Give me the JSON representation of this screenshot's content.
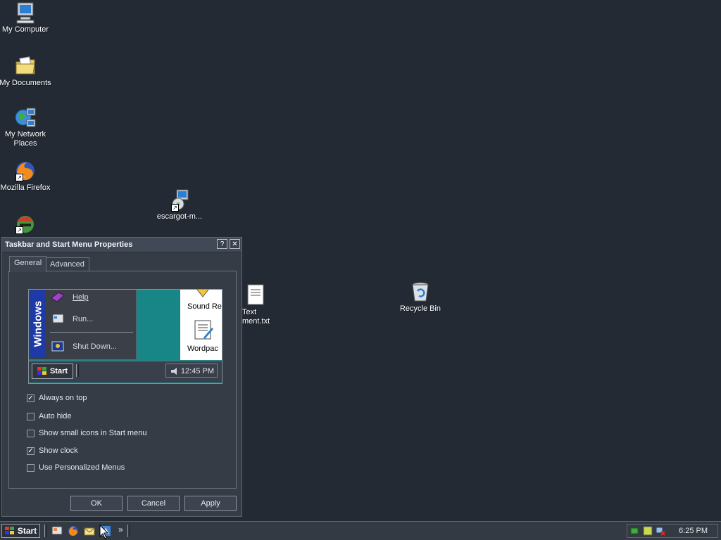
{
  "desktop": {
    "icons": [
      {
        "label": "My Computer"
      },
      {
        "label": "My Documents"
      },
      {
        "label": "My Network Places"
      },
      {
        "label": "Mozilla Firefox"
      },
      {
        "label": ""
      },
      {
        "label": "escargot-m..."
      },
      {
        "label": "Recycle Bin"
      },
      {
        "label": "Text\nment.txt"
      }
    ]
  },
  "dialog": {
    "title": "Taskbar and Start Menu Properties",
    "help_btn": "?",
    "close_btn": "✕",
    "tabs": [
      {
        "label": "General",
        "active": true
      },
      {
        "label": "Advanced",
        "active": false
      }
    ],
    "preview": {
      "band_text": "Windows",
      "items": [
        {
          "label": "Help"
        },
        {
          "label": "Run..."
        },
        {
          "label": "Shut Down..."
        }
      ],
      "doc_items": [
        "Sound Re",
        "Wordpac"
      ],
      "start_label": "Start",
      "clock": "12:45 PM"
    },
    "options": [
      {
        "label": "Always on top",
        "checked": true
      },
      {
        "label": "Auto hide",
        "checked": false
      },
      {
        "label": "Show small icons in Start menu",
        "checked": false
      },
      {
        "label": "Show clock",
        "checked": true
      },
      {
        "label": "Use Personalized Menus",
        "checked": false
      }
    ],
    "buttons": {
      "ok": "OK",
      "cancel": "Cancel",
      "apply": "Apply"
    }
  },
  "taskbar": {
    "start_label": "Start",
    "chevron": "»",
    "clock": "6:25 PM"
  }
}
